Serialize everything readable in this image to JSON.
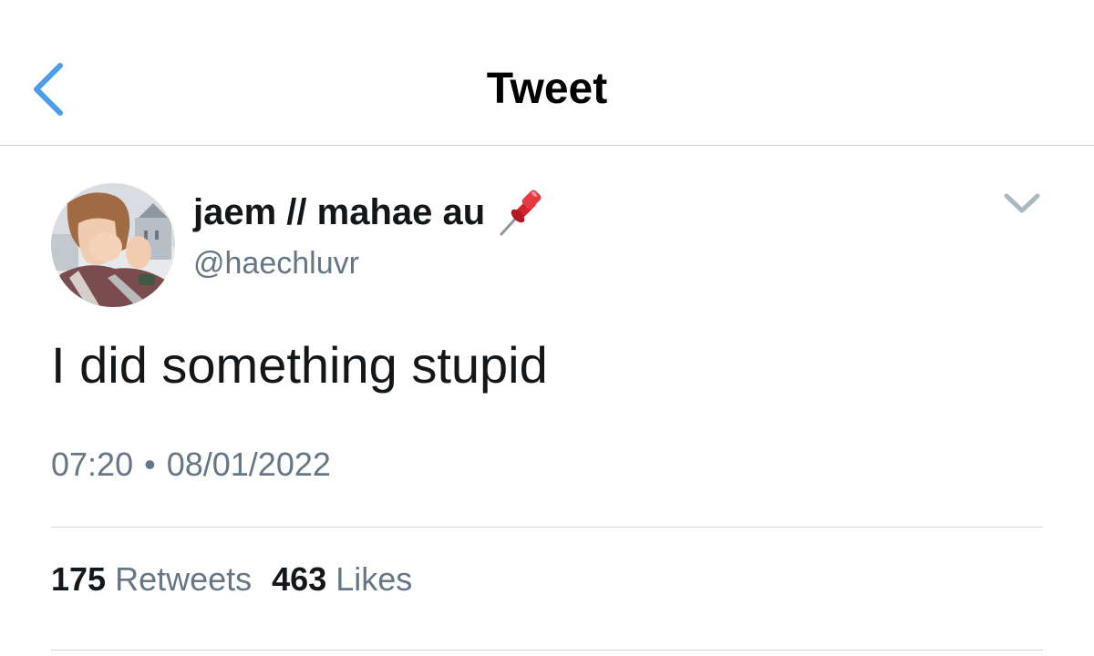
{
  "nav": {
    "title": "Tweet",
    "back_icon": "chevron-left-icon",
    "accent_color": "#4a9eeb"
  },
  "tweet": {
    "author": {
      "display_name": "jaem // mahae au",
      "name_emoji": "pushpin-icon",
      "handle": "@haechluvr"
    },
    "menu_icon": "chevron-down-icon",
    "text": "I did something stupid",
    "time": "07:20",
    "separator": "•",
    "date": "08/01/2022",
    "stats": {
      "retweets_count": "175",
      "retweets_label": "Retweets",
      "likes_count": "463",
      "likes_label": "Likes"
    }
  }
}
